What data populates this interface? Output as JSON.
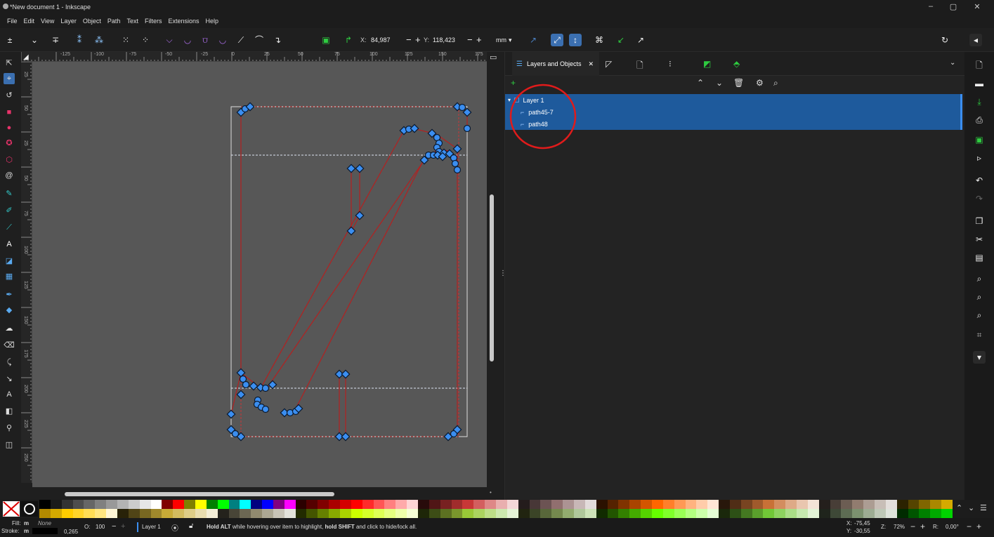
{
  "window": {
    "title": "*New document 1 - Inkscape",
    "minimize": "–",
    "maximize": "▢",
    "close": "✕"
  },
  "menu": [
    "File",
    "Edit",
    "View",
    "Layer",
    "Object",
    "Path",
    "Text",
    "Filters",
    "Extensions",
    "Help"
  ],
  "toolctrl": {
    "x_label": "X:",
    "x_value": "84,987",
    "y_label": "Y:",
    "y_value": "118,423",
    "unit": "mm"
  },
  "ruler_top_labels": [
    "-125",
    "-100",
    "-75",
    "-50",
    "-25",
    "0",
    "25",
    "50",
    "75",
    "100",
    "125",
    "150",
    "175"
  ],
  "ruler_left_labels": [
    "25",
    "50",
    "25",
    "50",
    "75",
    "100",
    "125",
    "150",
    "175",
    "200",
    "225",
    "250"
  ],
  "panel": {
    "tab_label": "Layers and Objects",
    "layers": [
      {
        "name": "Layer 1"
      },
      {
        "name": "path45-7"
      },
      {
        "name": "path48"
      }
    ]
  },
  "status": {
    "fill_label": "Fill:",
    "fill_value": "m",
    "fill_none": "None",
    "stroke_label": "Stroke:",
    "stroke_value": "m",
    "stroke_width": "0,265",
    "opacity_label": "O:",
    "opacity_value": "100",
    "layer_name": "Layer 1",
    "message_bold1": "Hold ALT",
    "message_mid": " while hovering over item to highlight, ",
    "message_bold2": "hold SHIFT",
    "message_end": " and click to hide/lock all.",
    "cursor_x_label": "X:",
    "cursor_x": "-75,45",
    "cursor_y_label": "Y:",
    "cursor_y": "-30,55",
    "zoom_label": "Z:",
    "zoom": "72%",
    "rotation_label": "R:",
    "rotation": "0,00°"
  },
  "colors": {
    "selection_blue": "#1e5a9c",
    "node_blue": "#3b8ef0",
    "path_red": "#b42020",
    "canvas_bg": "#575757"
  },
  "palette_colors": [
    "#000000",
    "#1a1a1a",
    "#333333",
    "#4d4d4d",
    "#666666",
    "#808080",
    "#999999",
    "#b3b3b3",
    "#cccccc",
    "#e6e6e6",
    "#ffffff",
    "#800000",
    "#ff0000",
    "#808000",
    "#ffff00",
    "#008000",
    "#00ff00",
    "#008080",
    "#00ffff",
    "#000080",
    "#0000ff",
    "#800080",
    "#ff00ff",
    "#2b0000",
    "#550000",
    "#800000",
    "#aa0000",
    "#d40000",
    "#ff0000",
    "#ff2a2a",
    "#ff5555",
    "#ff8080",
    "#ffaaaa",
    "#ffd5d5",
    "#280b0b",
    "#501616",
    "#782121",
    "#a02c2c",
    "#c83737",
    "#d35f5f",
    "#de8787",
    "#e9afaf",
    "#f4d7d7",
    "#241c1c",
    "#483737",
    "#6c5353",
    "#916f6f",
    "#ac9393",
    "#c8b7b7",
    "#e3dbdb",
    "#2b1100",
    "#552200",
    "#803300",
    "#aa4400",
    "#d45500",
    "#ff6600",
    "#ff7f2a",
    "#ff9955",
    "#ffb380",
    "#ffccaa",
    "#ffe6d5",
    "#28170b",
    "#502d16",
    "#784421",
    "#a05a2c",
    "#c87137",
    "#d38d5f",
    "#deaa87",
    "#e9c6af",
    "#f4e3d7",
    "#241f1c",
    "#483e37",
    "#6c5d53",
    "#917c6f",
    "#ac9d93",
    "#c8beb7",
    "#e3dedb",
    "#2b2200",
    "#554400",
    "#806600",
    "#aa8800",
    "#d4aa00"
  ],
  "palette_row2": [
    "#b38900",
    "#d4a900",
    "#ffcc00",
    "#ffd42a",
    "#ffdd55",
    "#ffe680",
    "#fff6d5",
    "#282208",
    "#504416",
    "#786721",
    "#a0892c",
    "#c8ab37",
    "#d3bc5f",
    "#decd87",
    "#e9ddaf",
    "#f4eed7",
    "#24221c",
    "#484537",
    "#6c6753",
    "#918a6f",
    "#aca793",
    "#c8c4b7",
    "#e3e2db",
    "#222b00",
    "#445500",
    "#668000",
    "#88aa00",
    "#aad400",
    "#ccff00",
    "#d4ff2a",
    "#ddff55",
    "#e5ff80",
    "#eeffaa",
    "#f6ffd5",
    "#1e2608",
    "#3d4d16",
    "#5c7021",
    "#7a962c",
    "#99c837",
    "#abd35f",
    "#bdde87",
    "#cde9af",
    "#e6f4d7",
    "#212410",
    "#3b4427",
    "#58673a",
    "#75894e",
    "#93ac6f",
    "#b0c89b",
    "#cde3b8",
    "#112b00",
    "#225500",
    "#338000",
    "#44aa00",
    "#55d400",
    "#66ff00",
    "#7fff2a",
    "#99ff55",
    "#b3ff80",
    "#ccffaa",
    "#e5ffd5",
    "#1a280b",
    "#2d5016",
    "#447821",
    "#5aa02c",
    "#71c837",
    "#8dd35f",
    "#aade87",
    "#c6e9af",
    "#e3f4d7",
    "#1f241c",
    "#3e4837",
    "#5d6c53",
    "#7c916f",
    "#9dac93",
    "#bec8b7",
    "#dee3db",
    "#002b00",
    "#005500",
    "#008000",
    "#00aa00",
    "#00d400"
  ]
}
